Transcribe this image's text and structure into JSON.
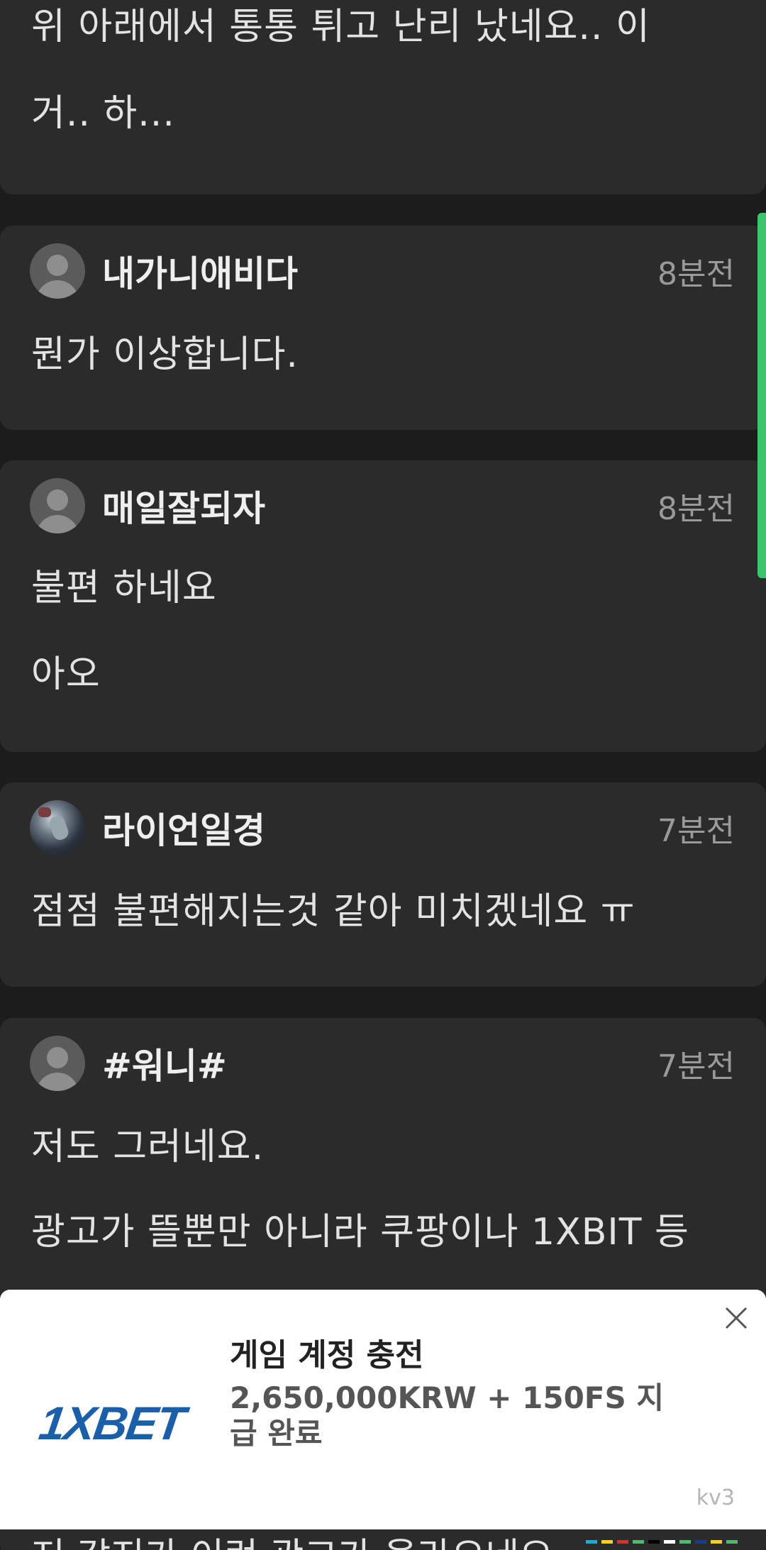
{
  "post_tail": {
    "line1": "위 아래에서 통통 튀고 난리 났네요.. 이",
    "line2": "거.. 하..."
  },
  "comments": [
    {
      "username": "내가니애비다",
      "time": "8분전",
      "lines": [
        "뭔가 이상합니다."
      ],
      "avatar": "default-avatar-icon"
    },
    {
      "username": "매일잘되자",
      "time": "8분전",
      "lines": [
        "불편 하네요",
        "아오"
      ],
      "avatar": "default-avatar-icon"
    },
    {
      "username": "라이언일경",
      "time": "7분전",
      "lines": [
        "점점 불편해지는것 같아 미치겠네요 ㅠ"
      ],
      "avatar": "profile-photo"
    },
    {
      "username": "#워니#",
      "time": "7분전",
      "lines": [
        "저도 그러네요.",
        "광고가 뜰뿐만 아니라 쿠팡이나 1XBIT 등"
      ],
      "avatar": "default-avatar-icon"
    }
  ],
  "partial_text": "저 같지가 이런 광고가 올라오네요..",
  "ad": {
    "brand": "1XBET",
    "title": "게임 계정 충전",
    "description": "2,650,000KRW + 150FS 지급 완료",
    "tag": "kv3",
    "close_icon": "close-icon"
  },
  "colors": {
    "background": "#1c1c1c",
    "card": "#2b2b2c",
    "scroll_indicator": "#3ec46d",
    "ad_brand": "#1a5fa8"
  }
}
